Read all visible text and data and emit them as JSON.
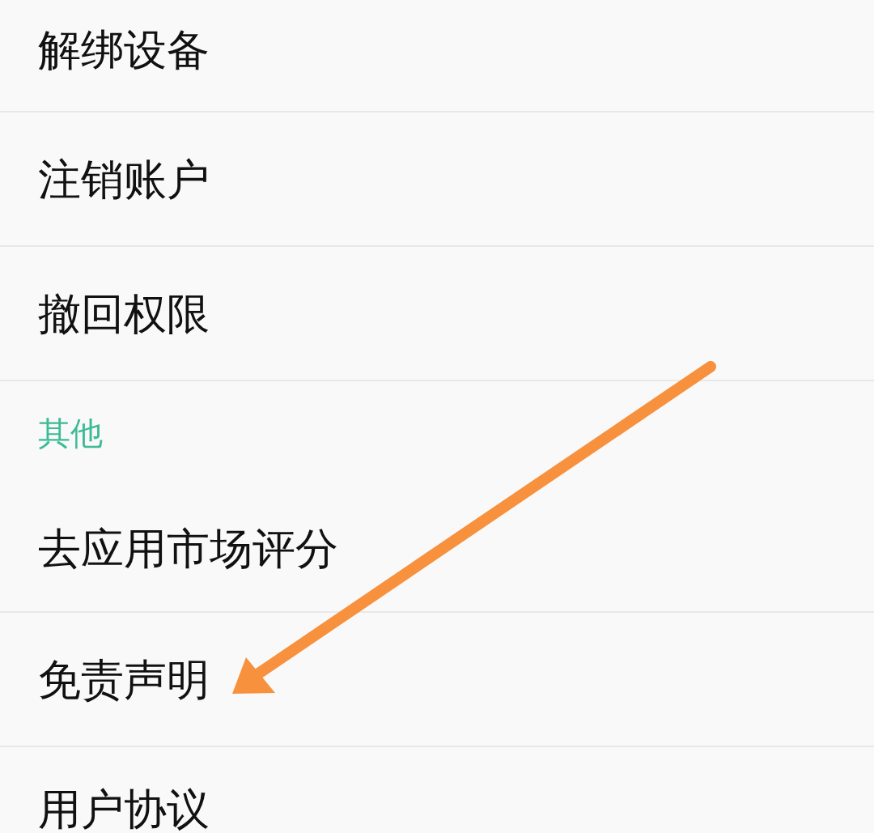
{
  "settings_list": [
    {
      "kind": "item",
      "label": "解绑设备"
    },
    {
      "kind": "item",
      "label": "注销账户"
    },
    {
      "kind": "item",
      "label": "撤回权限"
    },
    {
      "kind": "header",
      "label": "其他"
    },
    {
      "kind": "item",
      "label": "去应用市场评分"
    },
    {
      "kind": "item",
      "label": "免责声明"
    },
    {
      "kind": "item",
      "label": "用户协议"
    }
  ]
}
